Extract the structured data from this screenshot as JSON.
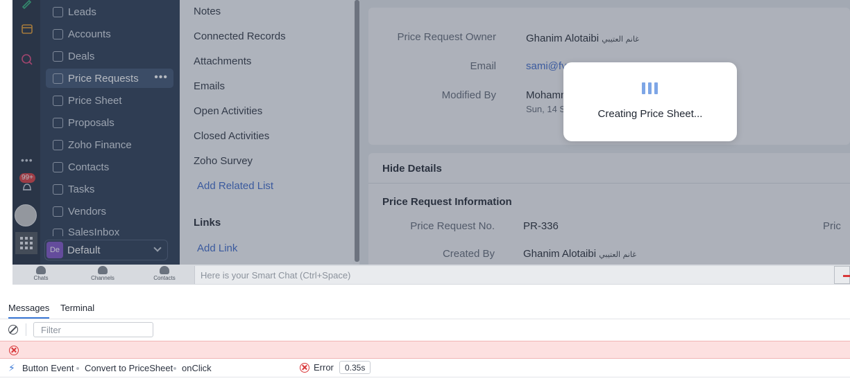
{
  "left_rail": {
    "notification_badge": "99+",
    "more_dots": "•••",
    "icons": [
      "edit-icon",
      "store-icon",
      "analytics-icon",
      "more-icon",
      "bell-icon",
      "user-avatar",
      "apps-grid-icon"
    ]
  },
  "module_nav": {
    "items": [
      {
        "label": "Leads",
        "icon": "leads-icon"
      },
      {
        "label": "Accounts",
        "icon": "accounts-icon"
      },
      {
        "label": "Deals",
        "icon": "deals-icon"
      },
      {
        "label": "Price Requests",
        "icon": "price-requests-icon",
        "active": true
      },
      {
        "label": "Price Sheet",
        "icon": "price-sheet-icon"
      },
      {
        "label": "Proposals",
        "icon": "proposals-icon"
      },
      {
        "label": "Zoho Finance",
        "icon": "finance-icon"
      },
      {
        "label": "Contacts",
        "icon": "contacts-icon"
      },
      {
        "label": "Tasks",
        "icon": "tasks-icon"
      },
      {
        "label": "Vendors",
        "icon": "vendors-icon"
      },
      {
        "label": "SalesInbox",
        "icon": "salesinbox-icon"
      }
    ],
    "more_label": "•••",
    "space": {
      "badge": "De",
      "label": "Default"
    }
  },
  "related_list": {
    "items": [
      "Notes",
      "Connected Records",
      "Attachments",
      "Emails",
      "Open Activities",
      "Closed Activities",
      "Zoho Survey"
    ],
    "add_related": "Add Related List",
    "links_heading": "Links",
    "add_link": "Add Link"
  },
  "record": {
    "owner_label": "Price Request Owner",
    "owner_value": "Ghanim Alotaibi",
    "owner_arabic": "غانم العتيبي",
    "email_label": "Email",
    "email_value": "sami@fvc",
    "modified_label": "Modified By",
    "modified_value": "Mohamm",
    "modified_date": "Sun, 14 S",
    "hide_details": "Hide Details",
    "info_heading": "Price Request Information",
    "no_label": "Price Request No.",
    "no_value": "PR-336",
    "created_label": "Created By",
    "created_value": "Ghanim Alotaibi",
    "created_arabic": "غانم العتيبي",
    "right_cut_label": "Pric"
  },
  "modal": {
    "message": "Creating Price Sheet..."
  },
  "crm_bottom": {
    "tabs": [
      "Chats",
      "Channels",
      "Contacts"
    ],
    "smart_chat_placeholder": "Here is your Smart Chat (Ctrl+Space)"
  },
  "console": {
    "tabs": [
      {
        "label": "Messages",
        "active": true
      },
      {
        "label": "Terminal",
        "active": false
      }
    ],
    "filter_placeholder": "Filter",
    "event": {
      "type": "Button Event",
      "name": "Convert to PriceSheet",
      "trigger": "onClick",
      "status": "Error",
      "duration": "0.35s"
    },
    "colors": {
      "error_bg": "#fde0e0",
      "accent": "#3a78d6",
      "error": "#d9383a"
    }
  }
}
